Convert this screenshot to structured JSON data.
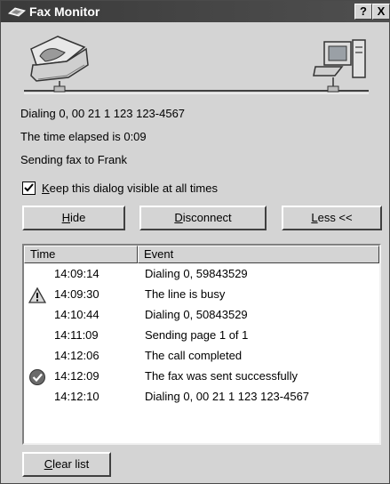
{
  "window": {
    "title": "Fax Monitor",
    "help_label": "?",
    "close_label": "X"
  },
  "status": {
    "dialing": "Dialing 0, 00 21 1 123 123-4567",
    "elapsed": "The time elapsed is 0:09",
    "sending": "Sending fax to Frank"
  },
  "options": {
    "keep_visible_label": "Keep this dialog visible at all times",
    "keep_visible_checked": true
  },
  "buttons": {
    "hide": "Hide",
    "disconnect": "Disconnect",
    "less": "Less <<",
    "clear_list": "Clear list"
  },
  "log": {
    "columns": [
      "Time",
      "Event"
    ],
    "rows": [
      {
        "time": "14:09:14",
        "event": "Dialing 0, 59843529",
        "icon": ""
      },
      {
        "time": "14:09:30",
        "event": "The line is busy",
        "icon": "warning-icon"
      },
      {
        "time": "14:10:44",
        "event": "Dialing 0, 50843529",
        "icon": ""
      },
      {
        "time": "14:11:09",
        "event": "Sending page 1 of 1",
        "icon": ""
      },
      {
        "time": "14:12:06",
        "event": "The call completed",
        "icon": ""
      },
      {
        "time": "14:12:09",
        "event": "The fax was sent successfully",
        "icon": "checkmark-icon"
      },
      {
        "time": "14:12:10",
        "event": "Dialing 0, 00 21 1 123 123-4567",
        "icon": ""
      }
    ]
  }
}
